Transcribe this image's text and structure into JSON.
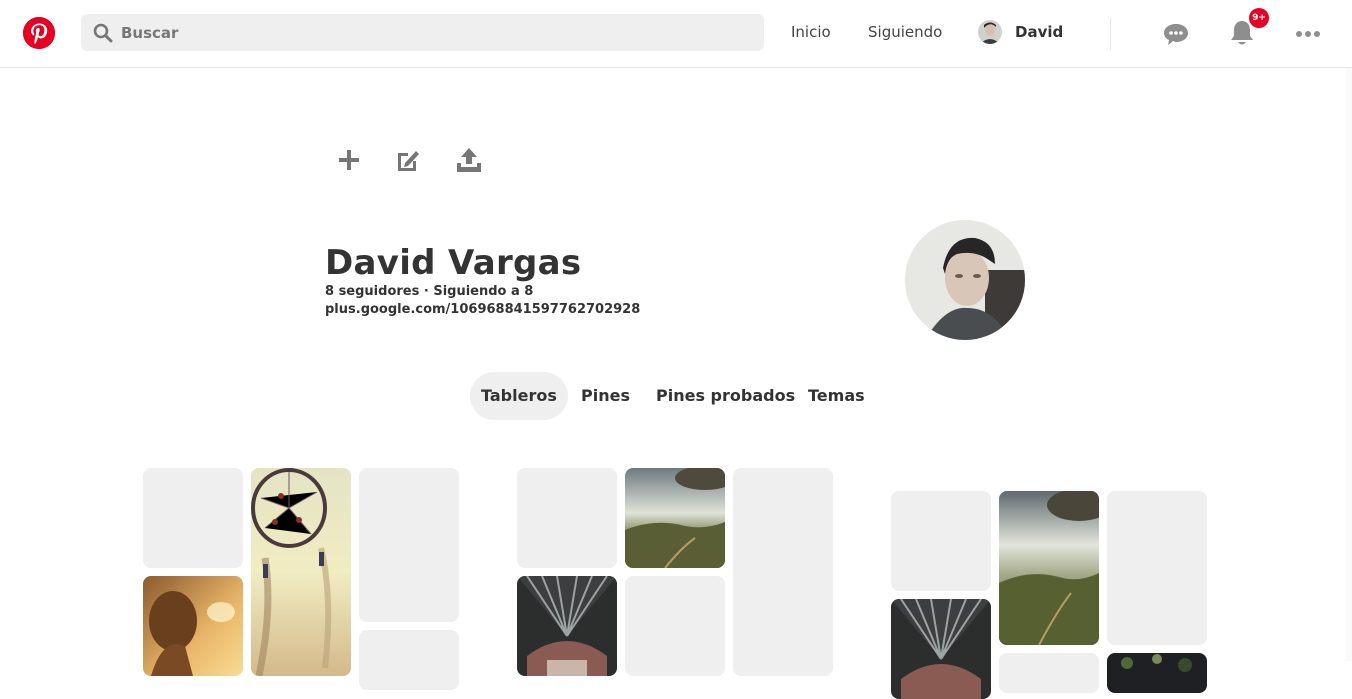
{
  "header": {
    "logo": "pinterest-logo",
    "search_placeholder": "Buscar",
    "nav_home": "Inicio",
    "nav_following": "Siguiendo",
    "user_name": "David",
    "notification_badge": "9+",
    "icons": [
      "search-icon",
      "chat-icon",
      "bell-icon",
      "more-icon"
    ]
  },
  "toolbar": {
    "icons": [
      "plus-icon",
      "edit-icon",
      "upload-icon"
    ]
  },
  "profile": {
    "name": "David Vargas",
    "stats": "8 seguidores · Siguiendo a 8",
    "link": "plus.google.com/106968841597762702928"
  },
  "tabs": [
    {
      "label": "Tableros",
      "active": true
    },
    {
      "label": "Pines",
      "active": false
    },
    {
      "label": "Pines probados",
      "active": false
    },
    {
      "label": "Temas",
      "active": false
    }
  ],
  "colors": {
    "brand": "#e60023",
    "tile_placeholder": "#efefef",
    "text": "#333333"
  }
}
